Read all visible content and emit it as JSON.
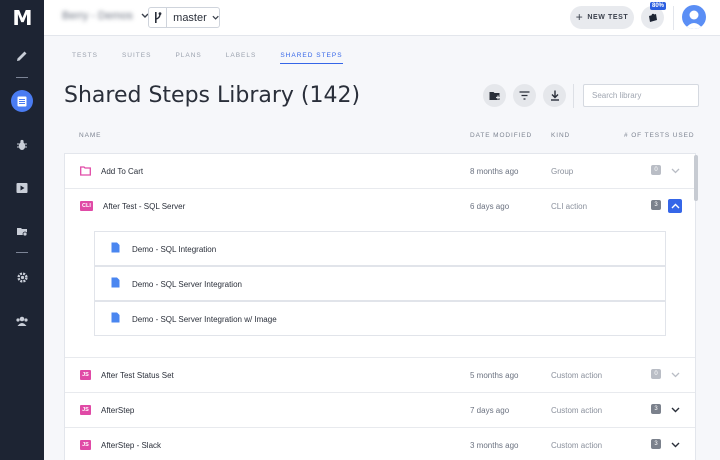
{
  "sidebar": {
    "logo": "M",
    "items": [
      "pencil-icon",
      "library-icon",
      "bug-icon",
      "play-icon",
      "folder-icon",
      "gear-icon",
      "users-icon"
    ],
    "active": "library-icon"
  },
  "topbar": {
    "project_name": "Berry - Demos",
    "branch": "master",
    "new_test_label": "NEW TEST",
    "progress_badge": "80%"
  },
  "tabs": [
    {
      "label": "TESTS",
      "active": false
    },
    {
      "label": "SUITES",
      "active": false
    },
    {
      "label": "PLANS",
      "active": false
    },
    {
      "label": "LABELS",
      "active": false
    },
    {
      "label": "SHARED STEPS",
      "active": true
    }
  ],
  "page": {
    "title": "Shared Steps Library (142)",
    "search_placeholder": "Search library"
  },
  "columns": {
    "name": "NAME",
    "date_modified": "DATE MODIFIED",
    "kind": "KIND",
    "tests_used": "# OF TESTS USED"
  },
  "rows": [
    {
      "icon": "folder-icon",
      "tag": "",
      "name": "Add To Cart",
      "date": "8 months ago",
      "kind": "Group",
      "count": "0",
      "expanded": false
    },
    {
      "icon": "",
      "tag": "CLI",
      "name": "After Test - SQL Server",
      "date": "6 days ago",
      "kind": "CLI action",
      "count": "3",
      "expanded": true
    },
    {
      "icon": "",
      "tag": "JS",
      "name": "After Test Status Set",
      "date": "5 months ago",
      "kind": "Custom action",
      "count": "0",
      "expanded": false
    },
    {
      "icon": "",
      "tag": "JS",
      "name": "AfterStep",
      "date": "7 days ago",
      "kind": "Custom action",
      "count": "3",
      "expanded": false
    },
    {
      "icon": "",
      "tag": "JS",
      "name": "AfterStep - Slack",
      "date": "3 months ago",
      "kind": "Custom action",
      "count": "3",
      "expanded": false
    }
  ],
  "used_in_tests": [
    "Demo - SQL Integration",
    "Demo - SQL Server Integration",
    "Demo - SQL Server Integration w/ Image"
  ],
  "colors": {
    "accent": "#3566e8",
    "rail": "#1d2433",
    "tag": "#e04aa6"
  }
}
